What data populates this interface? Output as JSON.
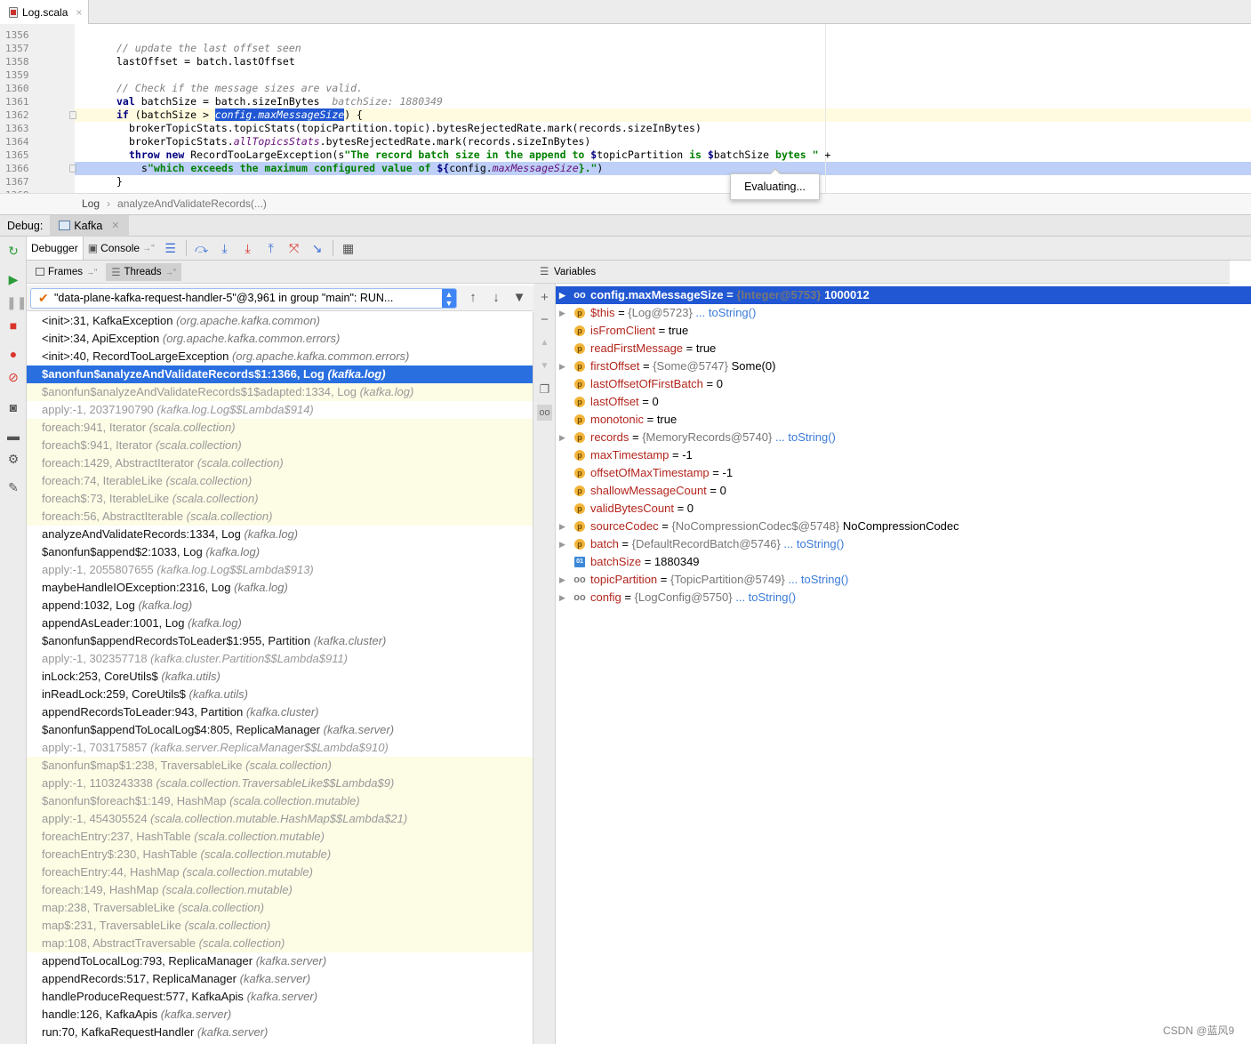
{
  "editor_tab": {
    "title": "Log.scala",
    "close": "×"
  },
  "editor": {
    "line_numbers": [
      "1356",
      "1357",
      "1358",
      "1359",
      "1360",
      "1361",
      "1362",
      "1363",
      "1364",
      "1365",
      "1366",
      "1367",
      "1368"
    ],
    "lines": {
      "l1357": "// update the last offset seen",
      "l1358": "lastOffset = batch.lastOffset",
      "l1360": "// Check if the message sizes are valid.",
      "l1361_a": "val",
      "l1361_b": " batchSize = batch.sizeInBytes",
      "l1361_hint": "batchSize: 1880349",
      "l1362_a": "if",
      "l1362_b": " (batchSize > ",
      "l1362_sel": "config.maxMessageSize",
      "l1362_c": ") {",
      "l1363": "brokerTopicStats.topicStats(topicPartition.topic).bytesRejectedRate.mark(records.sizeInBytes)",
      "l1364_a": "brokerTopicStats.",
      "l1364_b": "allTopicsStats",
      "l1364_c": ".bytesRejectedRate.mark(records.sizeInBytes)",
      "l1365_a": "throw new",
      "l1365_b": " RecordTooLargeException(s",
      "l1365_c": "\"The record batch size in the append to ",
      "l1365_d": "$",
      "l1365_e": "topicPartition",
      "l1365_f": " is ",
      "l1365_g": "$",
      "l1365_h": "batchSize",
      "l1365_i": " bytes \"",
      "l1365_j": " +",
      "l1366_a": "s",
      "l1366_b": "\"which exceeds the maximum configured value of ",
      "l1366_c": "${",
      "l1366_d": "config.",
      "l1366_e": "maxMessageSize",
      "l1366_f": "}.\"",
      "l1366_g": ")",
      "l1367": "}"
    },
    "tooltip": "Evaluating..."
  },
  "breadcrumb": {
    "item1": "Log",
    "sep": "›",
    "item2": "analyzeAndValidateRecords(...)"
  },
  "debug": {
    "label": "Debug:",
    "session_tab": "Kafka",
    "tabs": {
      "debugger": "Debugger",
      "console": "Console",
      "console_suffix": "→\""
    },
    "frames_tab": "Frames",
    "threads_tab": "Threads",
    "tab_suffix": "→\"",
    "thread_selector": "\"data-plane-kafka-request-handler-5\"@3,961 in group \"main\": RUN...",
    "variables_title": "Variables"
  },
  "frames": [
    {
      "m": "<init>:31, KafkaException",
      "p": "(org.apache.kafka.common)",
      "s": "normal"
    },
    {
      "m": "<init>:34, ApiException",
      "p": "(org.apache.kafka.common.errors)",
      "s": "normal"
    },
    {
      "m": "<init>:40, RecordTooLargeException",
      "p": "(org.apache.kafka.common.errors)",
      "s": "normal"
    },
    {
      "m": "$anonfun$analyzeAndValidateRecords$1:1366, Log",
      "p": "(kafka.log)",
      "s": "sel"
    },
    {
      "m": "$anonfun$analyzeAndValidateRecords$1$adapted:1334, Log",
      "p": "(kafka.log)",
      "s": "lib"
    },
    {
      "m": "apply:-1, 2037190790",
      "p": "(kafka.log.Log$$Lambda$914)",
      "s": "gray"
    },
    {
      "m": "foreach:941, Iterator",
      "p": "(scala.collection)",
      "s": "lib"
    },
    {
      "m": "foreach$:941, Iterator",
      "p": "(scala.collection)",
      "s": "lib"
    },
    {
      "m": "foreach:1429, AbstractIterator",
      "p": "(scala.collection)",
      "s": "lib"
    },
    {
      "m": "foreach:74, IterableLike",
      "p": "(scala.collection)",
      "s": "lib"
    },
    {
      "m": "foreach$:73, IterableLike",
      "p": "(scala.collection)",
      "s": "lib"
    },
    {
      "m": "foreach:56, AbstractIterable",
      "p": "(scala.collection)",
      "s": "lib"
    },
    {
      "m": "analyzeAndValidateRecords:1334, Log",
      "p": "(kafka.log)",
      "s": "normal"
    },
    {
      "m": "$anonfun$append$2:1033, Log",
      "p": "(kafka.log)",
      "s": "normal"
    },
    {
      "m": "apply:-1, 2055807655",
      "p": "(kafka.log.Log$$Lambda$913)",
      "s": "gray"
    },
    {
      "m": "maybeHandleIOException:2316, Log",
      "p": "(kafka.log)",
      "s": "normal"
    },
    {
      "m": "append:1032, Log",
      "p": "(kafka.log)",
      "s": "normal"
    },
    {
      "m": "appendAsLeader:1001, Log",
      "p": "(kafka.log)",
      "s": "normal"
    },
    {
      "m": "$anonfun$appendRecordsToLeader$1:955, Partition",
      "p": "(kafka.cluster)",
      "s": "normal"
    },
    {
      "m": "apply:-1, 302357718",
      "p": "(kafka.cluster.Partition$$Lambda$911)",
      "s": "gray"
    },
    {
      "m": "inLock:253, CoreUtils$",
      "p": "(kafka.utils)",
      "s": "normal"
    },
    {
      "m": "inReadLock:259, CoreUtils$",
      "p": "(kafka.utils)",
      "s": "normal"
    },
    {
      "m": "appendRecordsToLeader:943, Partition",
      "p": "(kafka.cluster)",
      "s": "normal"
    },
    {
      "m": "$anonfun$appendToLocalLog$4:805, ReplicaManager",
      "p": "(kafka.server)",
      "s": "normal"
    },
    {
      "m": "apply:-1, 703175857",
      "p": "(kafka.server.ReplicaManager$$Lambda$910)",
      "s": "gray"
    },
    {
      "m": "$anonfun$map$1:238, TraversableLike",
      "p": "(scala.collection)",
      "s": "lib"
    },
    {
      "m": "apply:-1, 1103243338",
      "p": "(scala.collection.TraversableLike$$Lambda$9)",
      "s": "lib"
    },
    {
      "m": "$anonfun$foreach$1:149, HashMap",
      "p": "(scala.collection.mutable)",
      "s": "lib"
    },
    {
      "m": "apply:-1, 454305524",
      "p": "(scala.collection.mutable.HashMap$$Lambda$21)",
      "s": "lib"
    },
    {
      "m": "foreachEntry:237, HashTable",
      "p": "(scala.collection.mutable)",
      "s": "lib"
    },
    {
      "m": "foreachEntry$:230, HashTable",
      "p": "(scala.collection.mutable)",
      "s": "lib"
    },
    {
      "m": "foreachEntry:44, HashMap",
      "p": "(scala.collection.mutable)",
      "s": "lib"
    },
    {
      "m": "foreach:149, HashMap",
      "p": "(scala.collection.mutable)",
      "s": "lib"
    },
    {
      "m": "map:238, TraversableLike",
      "p": "(scala.collection)",
      "s": "lib"
    },
    {
      "m": "map$:231, TraversableLike",
      "p": "(scala.collection)",
      "s": "lib"
    },
    {
      "m": "map:108, AbstractTraversable",
      "p": "(scala.collection)",
      "s": "lib"
    },
    {
      "m": "appendToLocalLog:793, ReplicaManager",
      "p": "(kafka.server)",
      "s": "normal"
    },
    {
      "m": "appendRecords:517, ReplicaManager",
      "p": "(kafka.server)",
      "s": "normal"
    },
    {
      "m": "handleProduceRequest:577, KafkaApis",
      "p": "(kafka.server)",
      "s": "normal"
    },
    {
      "m": "handle:126, KafkaApis",
      "p": "(kafka.server)",
      "s": "normal"
    },
    {
      "m": "run:70, KafkaRequestHandler",
      "p": "(kafka.server)",
      "s": "normal"
    }
  ],
  "variables": [
    {
      "badge": "oo",
      "expand": true,
      "name": "config.maxMessageSize",
      "eq": " = ",
      "ref": "{Integer@5753}",
      "val": " 1000012",
      "link": "",
      "sel": true
    },
    {
      "badge": "p",
      "expand": true,
      "name": "$this",
      "eq": " = ",
      "ref": "{Log@5723}",
      "val": "",
      "link": " ... toString()",
      "sel": false
    },
    {
      "badge": "p",
      "expand": false,
      "name": "isFromClient",
      "eq": " = ",
      "ref": "",
      "val": "true",
      "link": "",
      "sel": false
    },
    {
      "badge": "p",
      "expand": false,
      "name": "readFirstMessage",
      "eq": " = ",
      "ref": "",
      "val": "true",
      "link": "",
      "sel": false
    },
    {
      "badge": "p",
      "expand": true,
      "name": "firstOffset",
      "eq": " = ",
      "ref": "{Some@5747}",
      "val": " Some(0)",
      "link": "",
      "sel": false
    },
    {
      "badge": "p",
      "expand": false,
      "name": "lastOffsetOfFirstBatch",
      "eq": " = ",
      "ref": "",
      "val": "0",
      "link": "",
      "sel": false
    },
    {
      "badge": "p",
      "expand": false,
      "name": "lastOffset",
      "eq": " = ",
      "ref": "",
      "val": "0",
      "link": "",
      "sel": false
    },
    {
      "badge": "p",
      "expand": false,
      "name": "monotonic",
      "eq": " = ",
      "ref": "",
      "val": "true",
      "link": "",
      "sel": false
    },
    {
      "badge": "p",
      "expand": true,
      "name": "records",
      "eq": " = ",
      "ref": "{MemoryRecords@5740}",
      "val": "",
      "link": " ... toString()",
      "sel": false
    },
    {
      "badge": "p",
      "expand": false,
      "name": "maxTimestamp",
      "eq": " = ",
      "ref": "",
      "val": "-1",
      "link": "",
      "sel": false
    },
    {
      "badge": "p",
      "expand": false,
      "name": "offsetOfMaxTimestamp",
      "eq": " = ",
      "ref": "",
      "val": "-1",
      "link": "",
      "sel": false
    },
    {
      "badge": "p",
      "expand": false,
      "name": "shallowMessageCount",
      "eq": " = ",
      "ref": "",
      "val": "0",
      "link": "",
      "sel": false
    },
    {
      "badge": "p",
      "expand": false,
      "name": "validBytesCount",
      "eq": " = ",
      "ref": "",
      "val": "0",
      "link": "",
      "sel": false
    },
    {
      "badge": "p",
      "expand": true,
      "name": "sourceCodec",
      "eq": " = ",
      "ref": "{NoCompressionCodec$@5748}",
      "val": " NoCompressionCodec",
      "link": "",
      "sel": false
    },
    {
      "badge": "p",
      "expand": true,
      "name": "batch",
      "eq": " = ",
      "ref": "{DefaultRecordBatch@5746}",
      "val": "",
      "link": " ... toString()",
      "sel": false
    },
    {
      "badge": "01",
      "expand": false,
      "name": "batchSize",
      "eq": " = ",
      "ref": "",
      "val": "1880349",
      "link": "",
      "sel": false
    },
    {
      "badge": "oo",
      "expand": true,
      "name": "topicPartition",
      "eq": " = ",
      "ref": "{TopicPartition@5749}",
      "val": "",
      "link": " ... toString()",
      "sel": false
    },
    {
      "badge": "oo",
      "expand": true,
      "name": "config",
      "eq": " = ",
      "ref": "{LogConfig@5750}",
      "val": "",
      "link": " ... toString()",
      "sel": false
    }
  ],
  "watermark": "CSDN @蓝风9",
  "colors": {
    "selection": "#2157d3",
    "frame_selected": "#2a6fe0",
    "library_frame_bg": "#fdfce5",
    "exec_line": "#bed0f7",
    "var_name": "#b3261e"
  }
}
